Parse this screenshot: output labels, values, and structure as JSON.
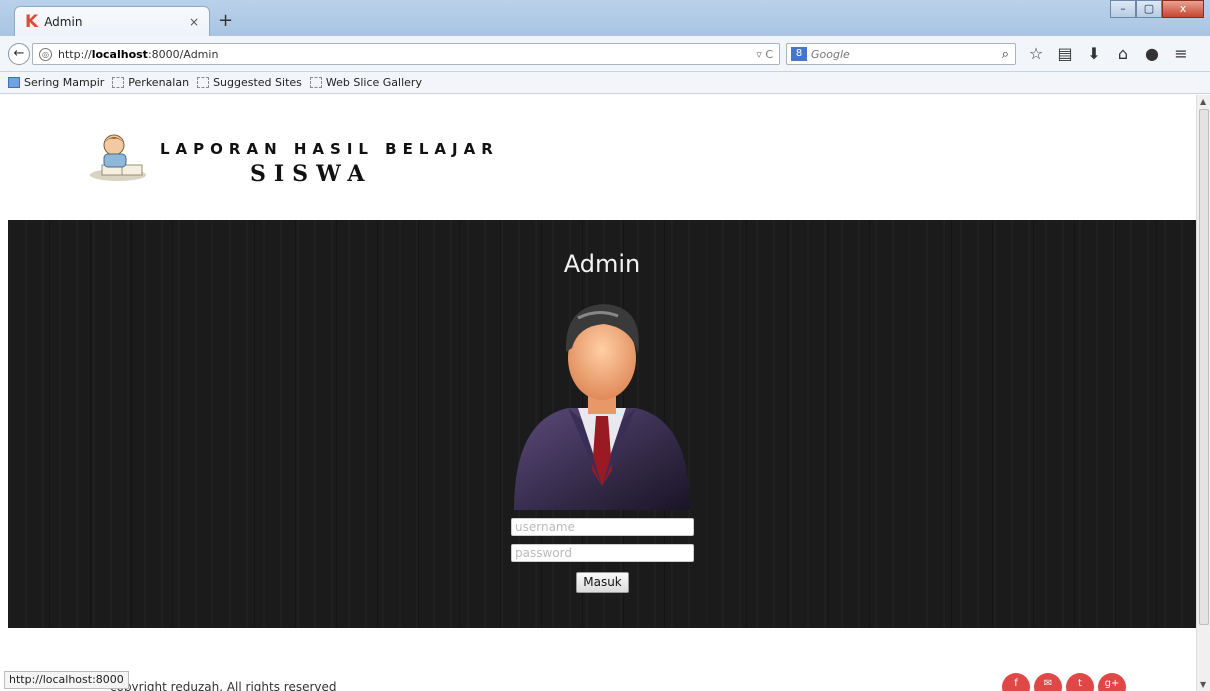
{
  "browser": {
    "tab_title": "Admin",
    "tab_logo": "K",
    "tab_close": "×",
    "new_tab": "+",
    "url_prefix": "http://",
    "url_host": "localhost",
    "url_path": ":8000/Admin",
    "url_icons": "▿ C",
    "search_engine_badge": "8",
    "search_placeholder": "Google",
    "window_buttons": {
      "minimize": "–",
      "maximize": "▢",
      "close": "x"
    }
  },
  "bookmarks": [
    "Sering Mampir",
    "Perkenalan",
    "Suggested Sites",
    "Web Slice Gallery"
  ],
  "page": {
    "brand_line1": "LAPORAN HASIL BELAJAR",
    "brand_line2": "SISWA",
    "hero_title": "Admin",
    "username_placeholder": "username",
    "password_placeholder": "password",
    "submit_label": "Masuk",
    "footer_text": "copyright reduzah. All rights reserved",
    "social": [
      "f",
      "✉",
      "t",
      "g+"
    ]
  },
  "status_url": "http://localhost:8000",
  "colors": {
    "hero_bg": "#1b1b1b",
    "social": "#e04848",
    "tab_logo": "#e34a3a"
  }
}
